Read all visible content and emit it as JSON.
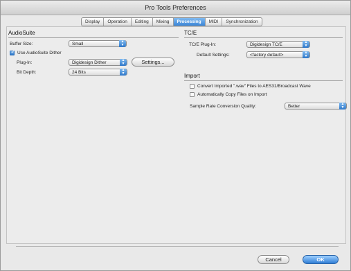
{
  "window": {
    "title": "Pro Tools Preferences"
  },
  "tabs": [
    {
      "label": "Display",
      "active": false
    },
    {
      "label": "Operation",
      "active": false
    },
    {
      "label": "Editing",
      "active": false
    },
    {
      "label": "Mixing",
      "active": false
    },
    {
      "label": "Processing",
      "active": true
    },
    {
      "label": "MIDI",
      "active": false
    },
    {
      "label": "Synchronization",
      "active": false
    }
  ],
  "audiosuite": {
    "title": "AudioSuite",
    "buffer_size_label": "Buffer Size:",
    "buffer_size_value": "Small",
    "use_dither_label": "Use AudioSuite Dither",
    "use_dither_checked": true,
    "plugin_label": "Plug-In:",
    "plugin_value": "Digidesign Dither",
    "settings_button": "Settings...",
    "bit_depth_label": "Bit Depth:",
    "bit_depth_value": "24 Bits"
  },
  "tce": {
    "title": "TC/E",
    "plugin_label": "TC/E Plug-In:",
    "plugin_value": "Digidesign TC/E",
    "default_label": "Default Settings:",
    "default_value": "<factory default>"
  },
  "import": {
    "title": "Import",
    "convert_label": "Convert Imported \".wav\" Files to AES31/Broadcast Wave",
    "convert_checked": false,
    "auto_copy_label": "Automatically Copy Files on Import",
    "auto_copy_checked": false,
    "src_quality_label": "Sample Rate Conversion Quality:",
    "src_quality_value": "Better"
  },
  "footer": {
    "cancel_label": "Cancel",
    "ok_label": "OK"
  },
  "colors": {
    "accent": "#3b86d8",
    "window_bg": "#ececec"
  },
  "icons": {
    "popup": "updown-arrows-icon",
    "check": "checkmark-icon"
  }
}
